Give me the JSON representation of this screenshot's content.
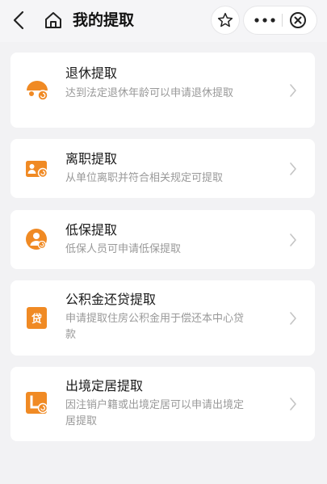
{
  "header": {
    "title": "我的提取",
    "icons": [
      "back-arrow-icon",
      "home-icon",
      "star-icon",
      "more-icon",
      "close-icon"
    ]
  },
  "colors": {
    "accent": "#f08a24",
    "background": "#f2f2f4",
    "card": "#ffffff",
    "desc_text": "#999999"
  },
  "items": [
    {
      "title": "退休提取",
      "desc": "达到法定退休年龄可以申请退休提取",
      "icon": "retirement-umbrella-icon"
    },
    {
      "title": "离职提取",
      "desc": "从单位离职并符合相关规定可提取",
      "icon": "resignation-card-icon"
    },
    {
      "title": "低保提取",
      "desc": "低保人员可申请低保提取",
      "icon": "low-income-person-icon"
    },
    {
      "title": "公积金还贷提取",
      "desc": "申请提取住房公积金用于偿还本中心贷款",
      "icon": "loan-repayment-icon"
    },
    {
      "title": "出境定居提取",
      "desc": "因注销户籍或出境定居可以申请出境定居提取",
      "icon": "emigration-settlement-icon"
    }
  ]
}
